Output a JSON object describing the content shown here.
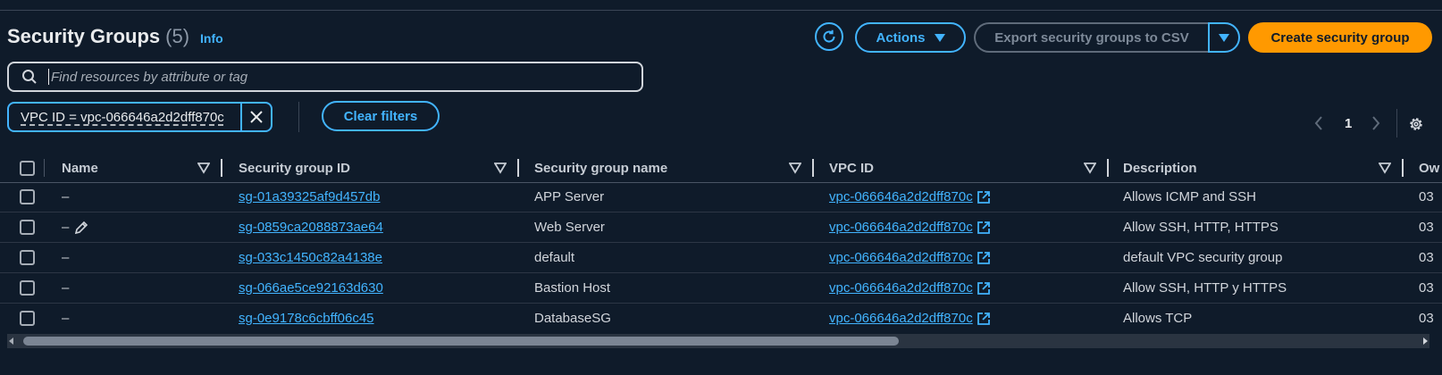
{
  "header": {
    "title": "Security Groups",
    "count": "(5)",
    "info": "Info",
    "actions_label": "Actions",
    "export_label": "Export security groups to CSV",
    "create_label": "Create security group"
  },
  "search": {
    "placeholder": "Find resources by attribute or tag"
  },
  "filter": {
    "token": "VPC ID = vpc-066646a2d2dff870c",
    "clear_label": "Clear filters"
  },
  "pagination": {
    "current_page": "1"
  },
  "table": {
    "columns": [
      "Name",
      "Security group ID",
      "Security group name",
      "VPC ID",
      "Description",
      "Ow"
    ],
    "rows": [
      {
        "name": "–",
        "sg_id": "sg-01a39325af9d457db",
        "sg_name": "APP Server",
        "vpc_id": "vpc-066646a2d2dff870c",
        "description": "Allows ICMP and SSH",
        "owner": "03"
      },
      {
        "name": "–",
        "sg_id": "sg-0859ca2088873ae64",
        "sg_name": "Web Server",
        "vpc_id": "vpc-066646a2d2dff870c",
        "description": "Allow SSH, HTTP, HTTPS",
        "owner": "03"
      },
      {
        "name": "–",
        "sg_id": "sg-033c1450c82a4138e",
        "sg_name": "default",
        "vpc_id": "vpc-066646a2d2dff870c",
        "description": "default VPC security group",
        "owner": "03"
      },
      {
        "name": "–",
        "sg_id": "sg-066ae5ce92163d630",
        "sg_name": "Bastion Host",
        "vpc_id": "vpc-066646a2d2dff870c",
        "description": "Allow SSH, HTTP y HTTPS",
        "owner": "03"
      },
      {
        "name": "–",
        "sg_id": "sg-0e9178c6cbff06c45",
        "sg_name": "DatabaseSG",
        "vpc_id": "vpc-066646a2d2dff870c",
        "description": "Allows TCP",
        "owner": "03"
      }
    ]
  },
  "colors": {
    "accent": "#42b4ff",
    "primary_button": "#ff9900",
    "background": "#0f1b2a"
  },
  "icons": [
    "refresh-icon",
    "caret-down-icon",
    "search-icon",
    "close-icon",
    "chevron-left-icon",
    "chevron-right-icon",
    "gear-icon",
    "sort-icon",
    "edit-pencil-icon",
    "external-link-icon"
  ]
}
